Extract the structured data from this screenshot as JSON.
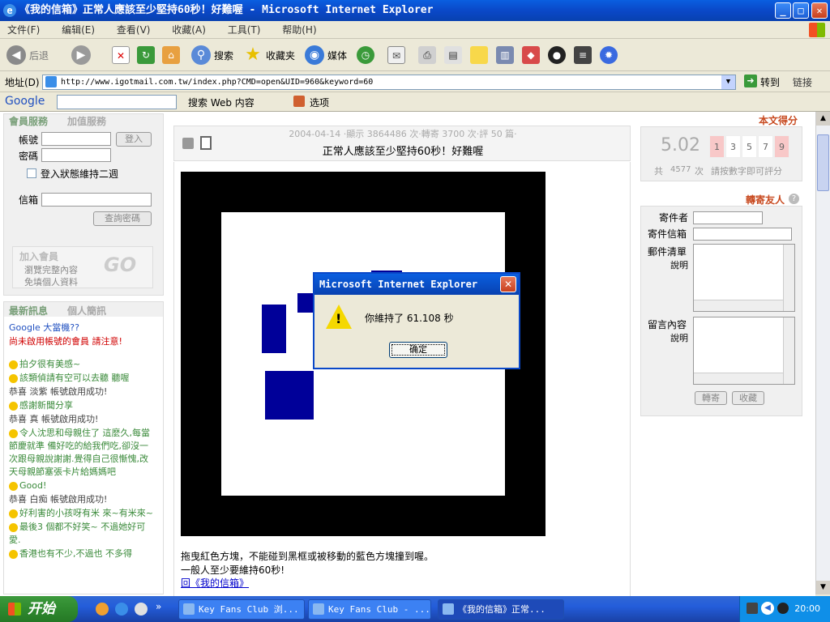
{
  "window": {
    "title": "《我的信箱》正常人應該至少堅持60秒！好難喔 - Microsoft Internet Explorer"
  },
  "menu": [
    "文件(F)",
    "编辑(E)",
    "查看(V)",
    "收藏(A)",
    "工具(T)",
    "帮助(H)"
  ],
  "toolbar": {
    "back": "后退",
    "search": "搜索",
    "favorites": "收藏夹",
    "media": "媒体"
  },
  "address": {
    "label": "地址(D)",
    "url": "http://www.igotmail.com.tw/index.php?CMD=open&UID=960&keyword=60",
    "go": "转到",
    "links": "链接"
  },
  "googlebar": {
    "logo": "Google",
    "search_web": "搜索 Web 内容",
    "options": "选项"
  },
  "login": {
    "tab1": "會員服務",
    "tab2": "加值服務",
    "account_label": "帳號",
    "password_label": "密碼",
    "login_button": "登入",
    "remember": "登入狀態維持二週",
    "mailbox_label": "信箱",
    "query_button": "查詢密碼",
    "join_title": "加入會員",
    "join_item1": "瀏覽完整內容",
    "join_item2": "免填個人資料",
    "go_text": "GO"
  },
  "news": {
    "tab1": "最新訊息",
    "tab2": "個人簡訊",
    "items": [
      {
        "text": "Google 大當機??",
        "style": "blue"
      },
      {
        "text": "尚未啟用帳號的會員 請注意!",
        "style": "red"
      },
      {
        "text": "拍夕很有美感~",
        "style": "green"
      },
      {
        "text": "該類偵請有空可以去聽 聽喔",
        "style": "green"
      },
      {
        "text": "恭喜 淡紫 帳號啟用成功!",
        "style": "gray"
      },
      {
        "text": "感謝新聞分享",
        "style": "green"
      },
      {
        "text": "恭喜 真 帳號啟用成功!",
        "style": "gray"
      },
      {
        "text": "令人沈思和母親住了 這麼久,每當節慶就準 備好吃的給我們吃,卻沒一次跟母親說謝謝.覺得自己很慚愧,改 天母親節塞張卡片給媽媽吧",
        "style": "green"
      },
      {
        "text": "Good!",
        "style": "green"
      },
      {
        "text": "恭喜 白痴 帳號啟用成功!",
        "style": "gray"
      },
      {
        "text": "好利害的小孩呀有米 來~有米來~",
        "style": "green"
      },
      {
        "text": "最後3 個都不好笑~ 不過她好可愛.",
        "style": "green"
      },
      {
        "text": "香港也有不少,不過也 不多得",
        "style": "green"
      }
    ]
  },
  "article": {
    "meta": "2004-04-14 ‧顯示 3864486 次‧轉寄 3700 次‧評 50 篇‧",
    "title": "正常人應該至少堅持60秒！好難喔",
    "description": "拖曳紅色方塊，不能碰到黑框或被移動的藍色方塊撞到喔。",
    "note": "一般人至少要維持60秒!",
    "back_link": "回《我的信箱》"
  },
  "rating": {
    "header": "本文得分",
    "score": "5.02",
    "total_label": "共",
    "count": "4577",
    "count_unit": "次",
    "hint": "請按數字即可評分",
    "options": [
      "1",
      "3",
      "5",
      "7",
      "9"
    ]
  },
  "forward": {
    "header": "轉寄友人",
    "sender_label": "寄件者",
    "sender_mail_label": "寄件信箱",
    "list_label": "郵件清單",
    "list_desc": "說明",
    "message_label": "留言內容",
    "message_desc": "說明",
    "send_button": "轉寄",
    "fav_button": "收藏"
  },
  "dialog": {
    "title": "Microsoft Internet Explorer",
    "message": "你維持了 61.108 秒",
    "ok": "确定"
  },
  "taskbar": {
    "start": "开始",
    "tasks": [
      "Key Fans Club 浏...",
      "Key Fans Club - ...",
      "《我的信箱》正常..."
    ],
    "clock": "20:00"
  }
}
